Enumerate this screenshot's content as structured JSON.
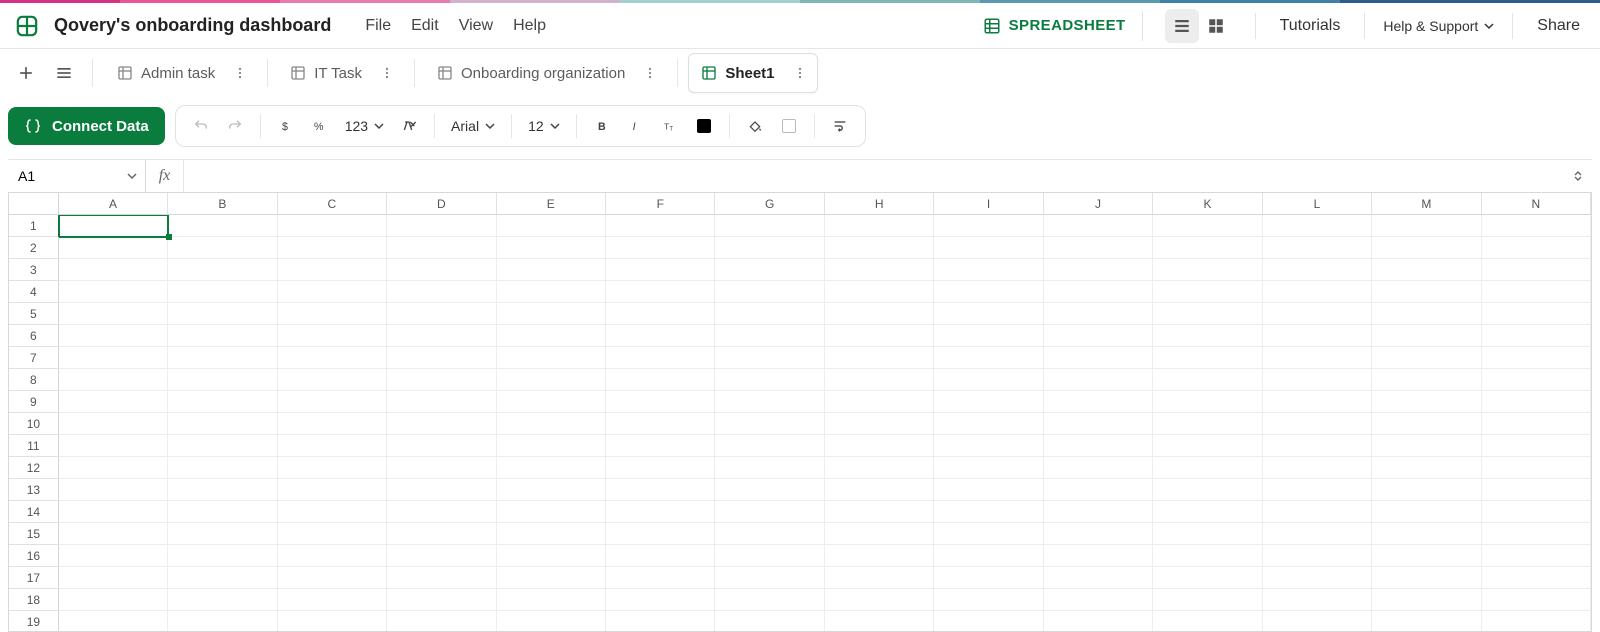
{
  "colors": {
    "accent": "#0a7d3e"
  },
  "header": {
    "doc_title": "Qovery's onboarding dashboard",
    "menu": {
      "file": "File",
      "edit": "Edit",
      "view": "View",
      "help": "Help"
    },
    "mode_label": "SPREADSHEET",
    "tutorials": "Tutorials",
    "help_support": "Help & Support",
    "share": "Share"
  },
  "tabs": [
    {
      "label": "Admin task",
      "active": false
    },
    {
      "label": "IT Task",
      "active": false
    },
    {
      "label": "Onboarding organization",
      "active": false
    },
    {
      "label": "Sheet1",
      "active": true
    }
  ],
  "toolbar": {
    "connect_label": "Connect Data",
    "num_format": "123",
    "font": "Arial",
    "font_size": "12"
  },
  "namebox": {
    "value": "A1"
  },
  "formula": {
    "value": ""
  },
  "grid": {
    "columns": [
      "A",
      "B",
      "C",
      "D",
      "E",
      "F",
      "G",
      "H",
      "I",
      "J",
      "K",
      "L",
      "M",
      "N"
    ],
    "rows": 19,
    "selected": {
      "col": 0,
      "row": 0
    }
  }
}
